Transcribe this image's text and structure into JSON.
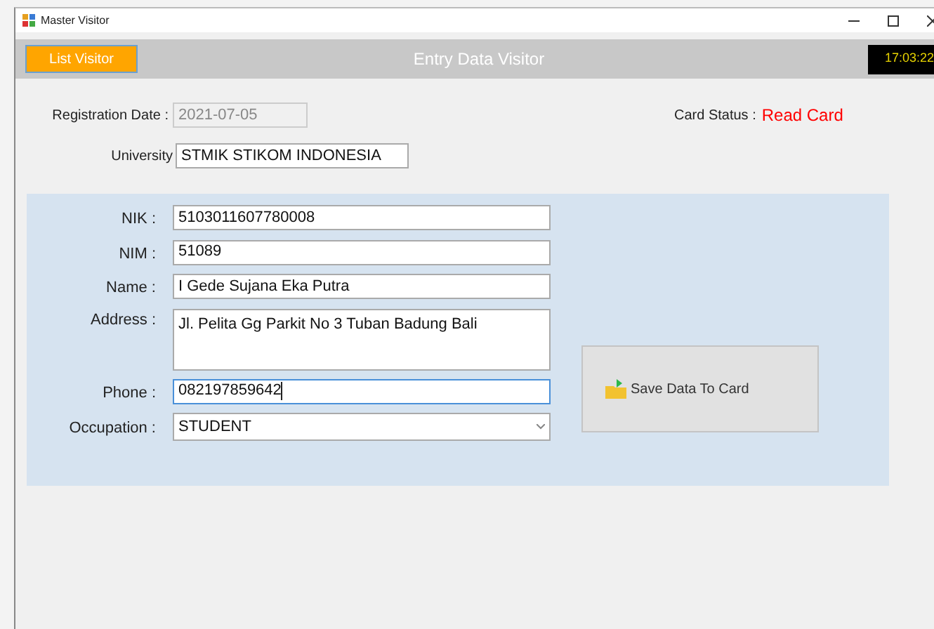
{
  "window": {
    "title": "Master Visitor"
  },
  "header": {
    "list_button": "List Visitor",
    "title": "Entry Data Visitor",
    "clock": "17:03:22"
  },
  "registration": {
    "label": "Registration Date :",
    "value": "2021-07-05",
    "disabled": true
  },
  "card_status": {
    "label": "Card Status :",
    "value": "Read Card"
  },
  "university": {
    "label": "University",
    "value": "STMIK STIKOM INDONESIA"
  },
  "fields": [
    {
      "kind": "text",
      "label": "NIK :",
      "value": "5103011607780008",
      "focused": false
    },
    {
      "kind": "text",
      "label": "NIM :",
      "value": "51089",
      "focused": false
    },
    {
      "kind": "text",
      "label": "Name :",
      "value": "I Gede Sujana Eka Putra",
      "focused": false
    },
    {
      "kind": "textarea",
      "label": "Address :",
      "value": "Jl. Pelita Gg Parkit No 3 Tuban Badung Bali",
      "focused": false
    },
    {
      "kind": "text",
      "label": "Phone :",
      "value": "082197859642",
      "focused": true
    },
    {
      "kind": "select",
      "label": "Occupation :",
      "value": "STUDENT",
      "focused": false
    }
  ],
  "save_button": "Save Data To Card"
}
